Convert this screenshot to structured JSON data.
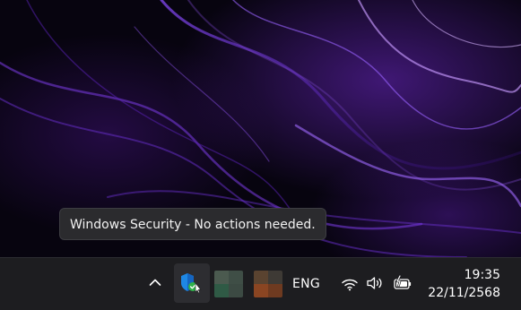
{
  "tooltip": {
    "text": "Windows Security - No actions needed."
  },
  "taskbar": {
    "overflow_icon": "chevron-up-icon",
    "security_icon": "windows-security-shield-icon",
    "language": "ENG",
    "network_icon": "wifi-icon",
    "volume_icon": "speaker-icon",
    "battery_icon": "battery-charging-icon",
    "time": "19:35",
    "date": "22/11/2568"
  },
  "colors": {
    "taskbar_bg": "#1d1d20",
    "tooltip_bg": "#2b2b2e",
    "shield_blue": "#1e88e5",
    "check_green": "#2fb34a",
    "wallpaper_accent": "#6a2fd0"
  }
}
